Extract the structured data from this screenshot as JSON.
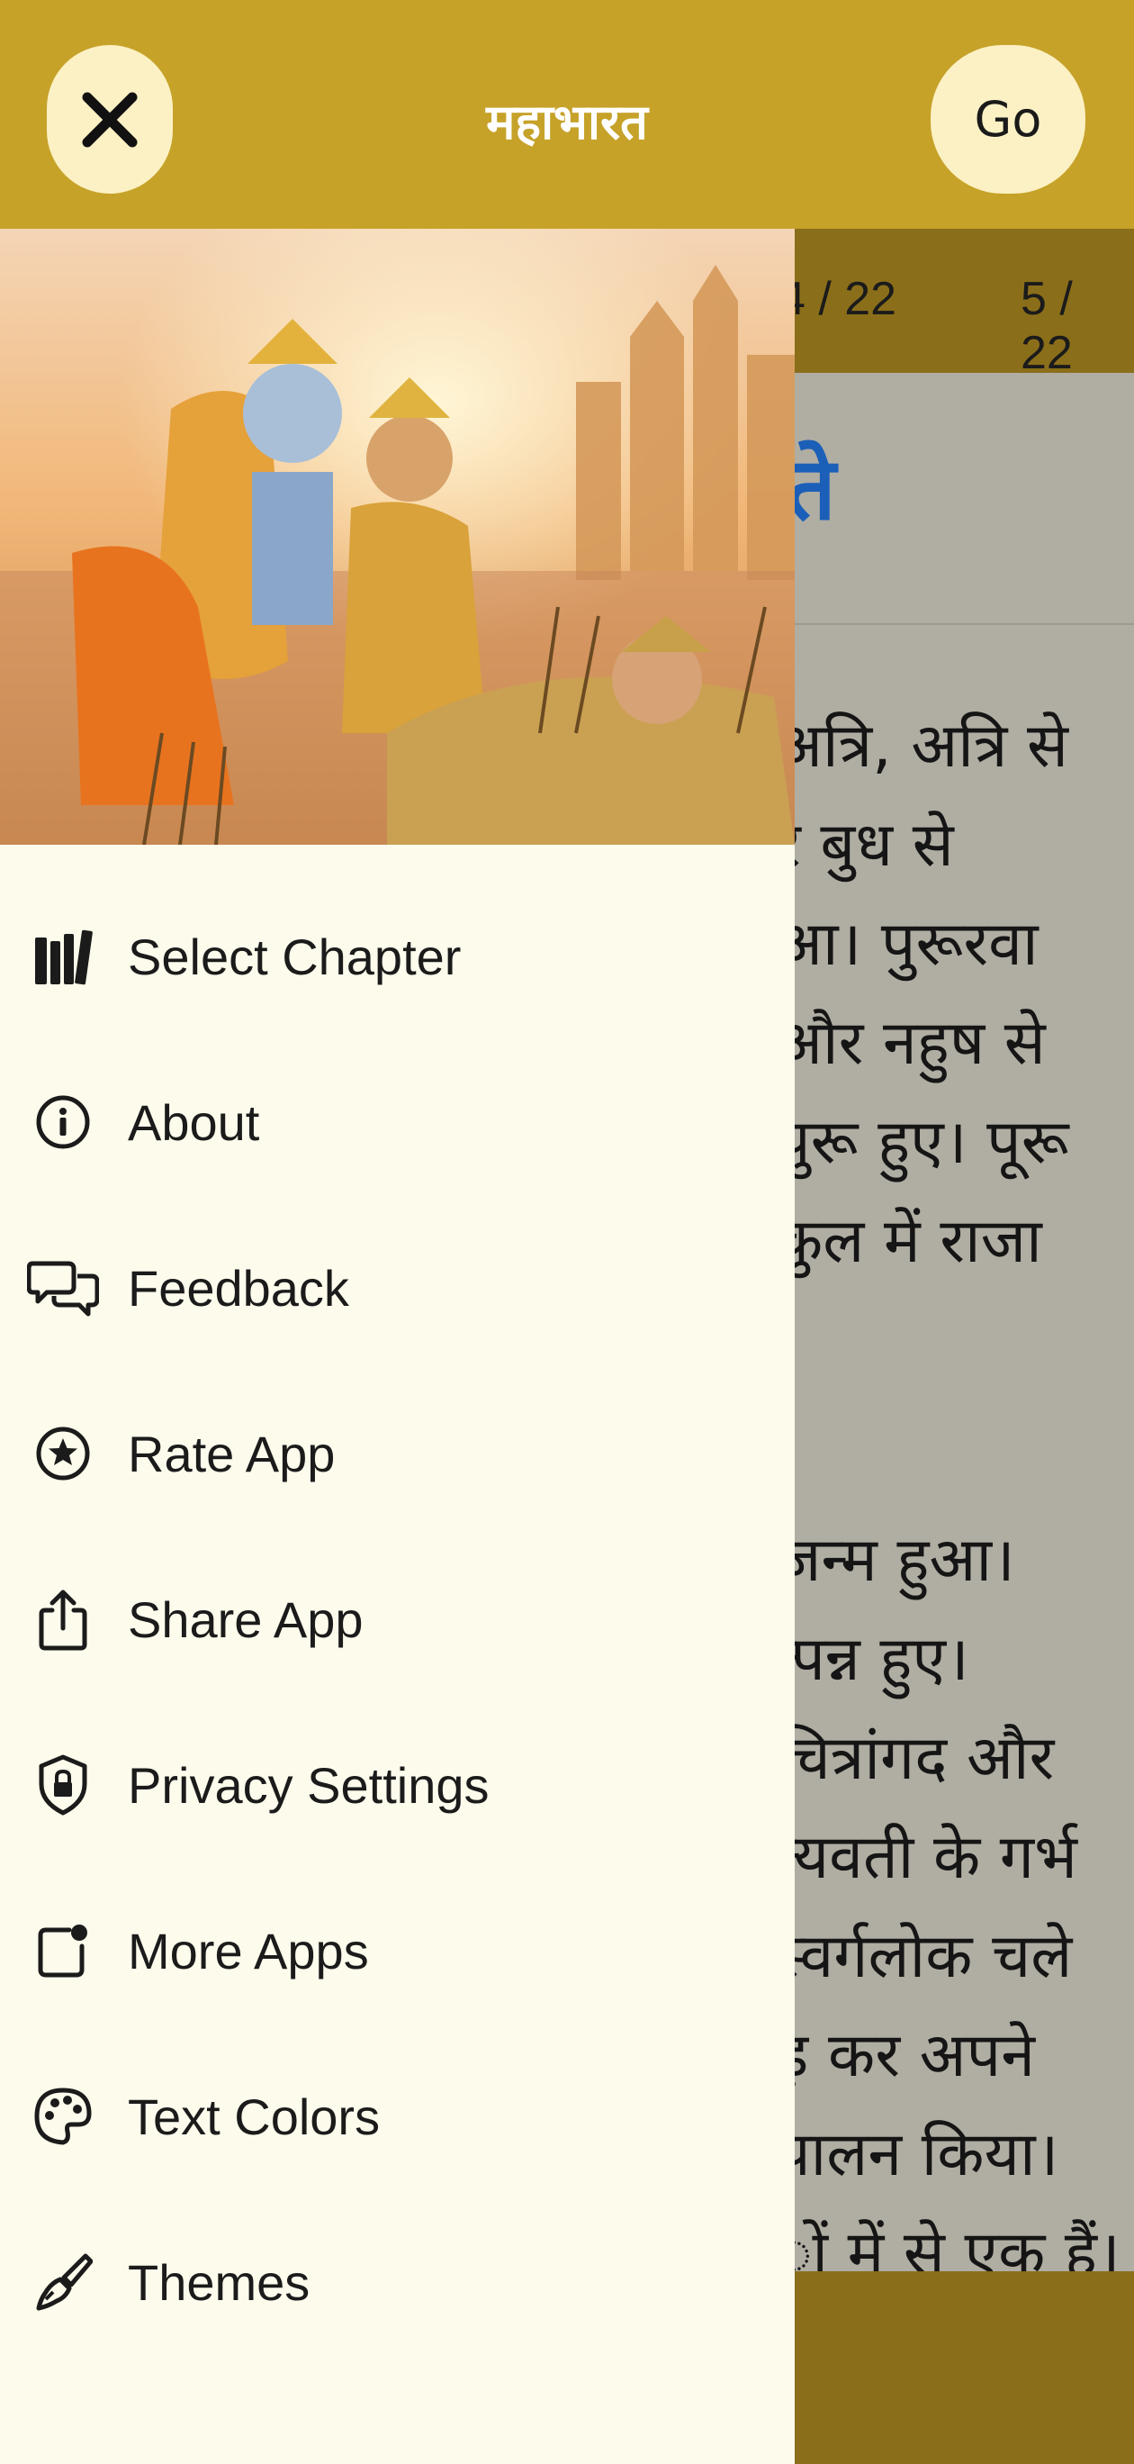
{
  "header": {
    "title": "महाभारत",
    "close_icon": "close-icon",
    "go_label": "Go"
  },
  "chapter_tabs": [
    "4 / 22",
    "5 / 22"
  ],
  "reading": {
    "heading_fragment": "ते",
    "lines_a": [
      "अत्रि, अत्रि से",
      "र बुध से",
      "आ। पुरूरवा",
      "और नहुष से",
      "पुरू हुए। पूरू",
      "कुल में राजा"
    ],
    "lines_b": [
      "जन्म हुआ।",
      "त्पन्न हुए।",
      "चित्रांगद और",
      "त्यवती के गर्भ",
      "स्वर्गलोक चले",
      "ड़ कर अपने",
      "पालन किया।",
      "ों में से एक हैं।"
    ]
  },
  "drawer": {
    "menu": [
      {
        "label": "Select Chapter",
        "icon": "books-icon"
      },
      {
        "label": "About",
        "icon": "info-icon"
      },
      {
        "label": "Feedback",
        "icon": "chat-bubbles-icon"
      },
      {
        "label": "Rate App",
        "icon": "star-badge-icon"
      },
      {
        "label": "Share App",
        "icon": "share-icon"
      },
      {
        "label": "Privacy Settings",
        "icon": "shield-lock-icon"
      },
      {
        "label": "More Apps",
        "icon": "app-notification-icon"
      },
      {
        "label": "Text Colors",
        "icon": "palette-icon"
      },
      {
        "label": "Themes",
        "icon": "paintbrush-icon"
      }
    ]
  },
  "colors": {
    "header": "#c6a229",
    "chapter_bar": "#8a6e1a",
    "drawer_bg": "#fdfbec",
    "button_bg": "#fcf1c4",
    "heading_blue": "#1b5fb8"
  }
}
